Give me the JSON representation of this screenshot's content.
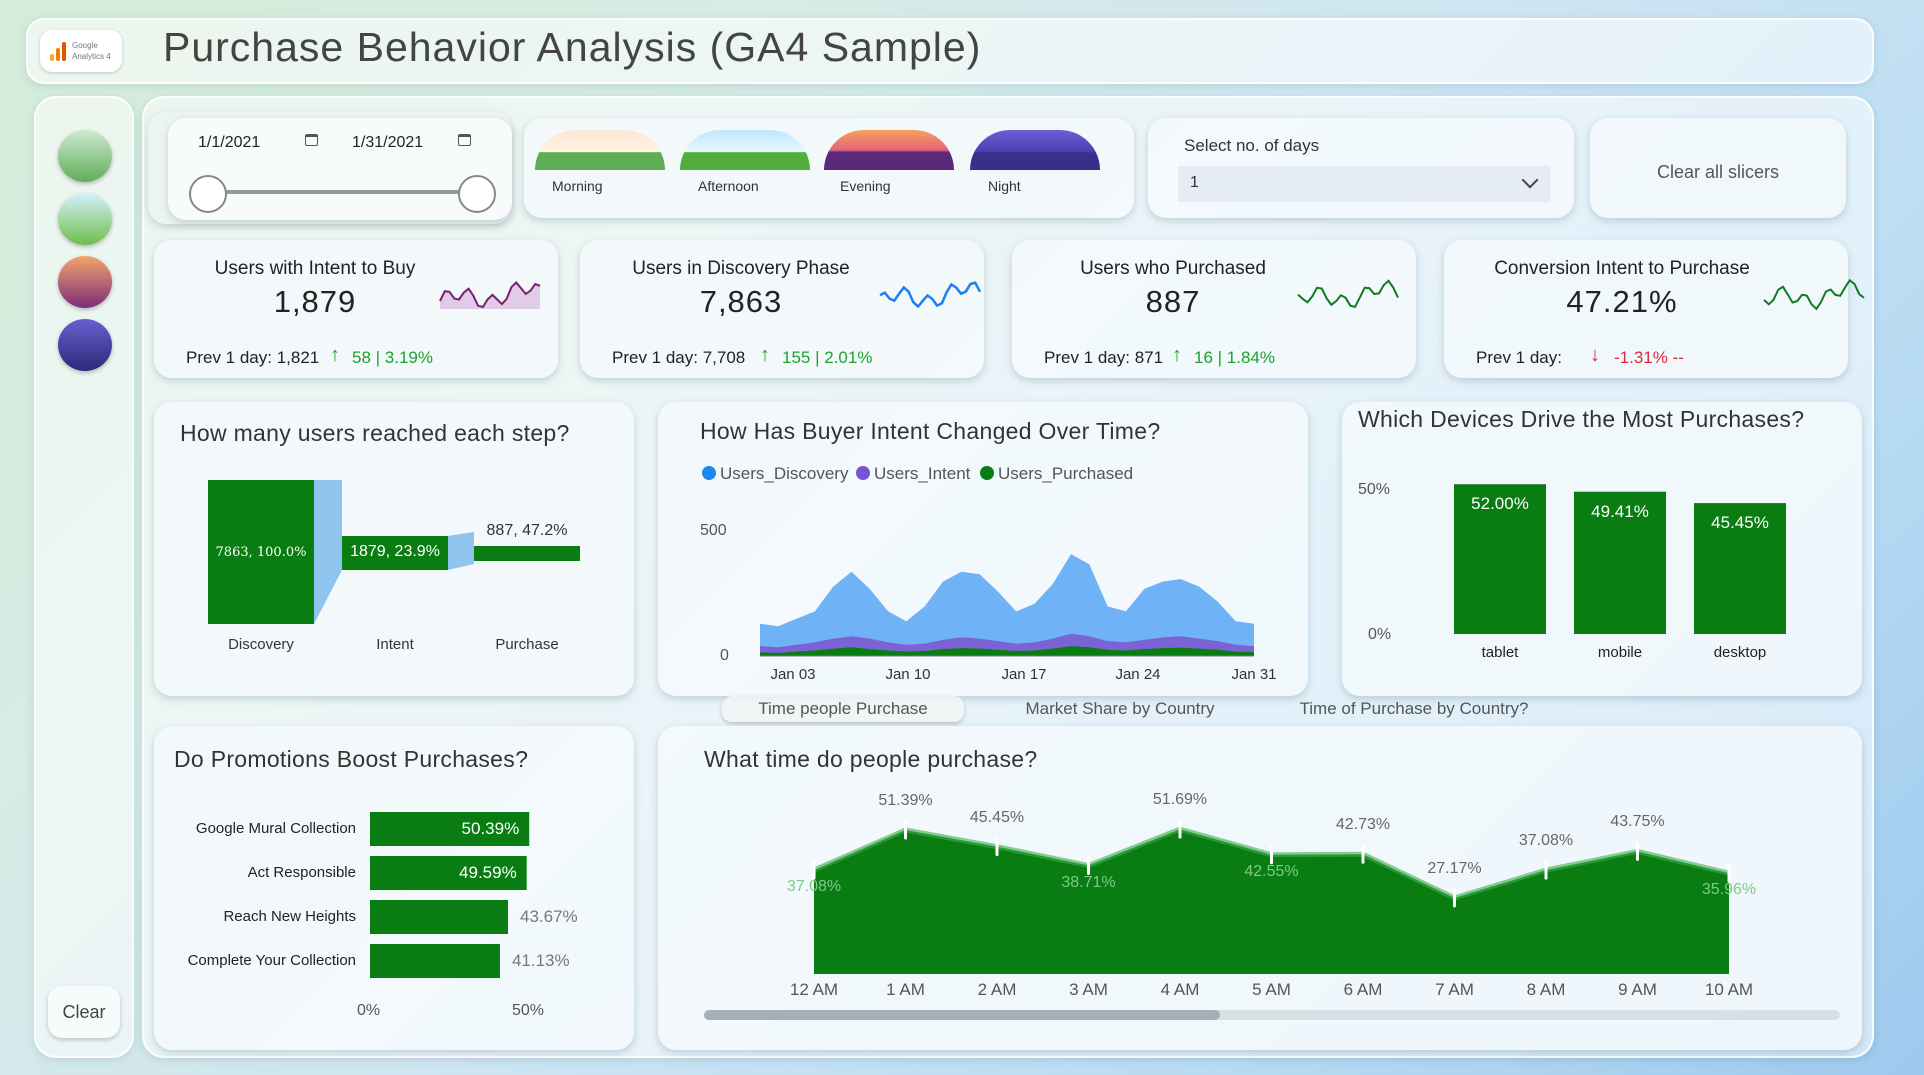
{
  "header": {
    "title": "Purchase Behavior Analysis (GA4 Sample)",
    "logo_line1": "Google",
    "logo_line2": "Analytics 4"
  },
  "sidebar": {
    "icons": [
      "morning-icon",
      "afternoon-icon",
      "evening-icon",
      "night-icon"
    ],
    "clear_label": "Clear"
  },
  "filters": {
    "date_start": "1/1/2021",
    "date_end": "1/31/2021",
    "times": [
      {
        "label": "Morning"
      },
      {
        "label": "Afternoon"
      },
      {
        "label": "Evening"
      },
      {
        "label": "Night"
      }
    ],
    "days_label": "Select no. of days",
    "days_value": "1",
    "clear_all": "Clear all slicers"
  },
  "kpis": [
    {
      "title": "Users with Intent to Buy",
      "value": "1,879",
      "prev": "Prev 1 day: 1,821",
      "arrow": "↑",
      "delta": "58 | 3.19%",
      "delta_color": "#1fa02c",
      "spark_color": "#7a1f6e"
    },
    {
      "title": "Users in Discovery Phase",
      "value": "7,863",
      "prev": "Prev 1 day: 7,708",
      "arrow": "↑",
      "delta": "155 | 2.01%",
      "delta_color": "#1fa02c",
      "spark_color": "#1e7ff0"
    },
    {
      "title": "Users who Purchased",
      "value": "887",
      "prev": "Prev 1 day: 871",
      "arrow": "↑",
      "delta": "16 | 1.84%",
      "delta_color": "#1fa02c",
      "spark_color": "#127a1e"
    },
    {
      "title": "Conversion Intent to Purchase",
      "value": "47.21%",
      "prev": "Prev 1 day:",
      "arrow": "↓",
      "delta": "-1.31% --",
      "delta_color": "#e0283c",
      "spark_color": "#127a1e"
    }
  ],
  "funnel": {
    "title": "How many users reached each step?",
    "steps": [
      {
        "label": "Discovery",
        "value": "7863, 100.0%"
      },
      {
        "label": "Intent",
        "value": "1879, 23.9%"
      },
      {
        "label": "Purchase",
        "value": "887, 47.2%"
      }
    ]
  },
  "intent_chart": {
    "title": "How Has Buyer Intent Changed Over Time?",
    "legend": [
      {
        "name": "Users_Discovery",
        "color": "#1e88f0"
      },
      {
        "name": "Users_Intent",
        "color": "#7b52d6"
      },
      {
        "name": "Users_Purchased",
        "color": "#0a7d12"
      }
    ],
    "y_ticks": [
      "500",
      "0"
    ],
    "x_ticks": [
      "Jan 03",
      "Jan 10",
      "Jan 17",
      "Jan 24",
      "Jan 31"
    ]
  },
  "devices": {
    "title": "Which Devices Drive the Most Purchases?",
    "y_ticks": [
      "50%",
      "0%"
    ]
  },
  "tabs": [
    "Time people Purchase",
    "Market Share by Country",
    "Time of Purchase by Country?"
  ],
  "promotions": {
    "title": "Do Promotions Boost Purchases?",
    "x_ticks": [
      "0%",
      "50%"
    ]
  },
  "hourly": {
    "title": "What time do people purchase?"
  },
  "chart_data": [
    {
      "type": "bar",
      "title": "Which Devices Drive the Most Purchases?",
      "categories": [
        "tablet",
        "mobile",
        "desktop"
      ],
      "values": [
        52.0,
        49.41,
        45.45
      ],
      "labels": [
        "52.00%",
        "49.41%",
        "45.45%"
      ],
      "ylim": [
        0,
        55
      ],
      "color": "#0a7d12"
    },
    {
      "type": "bar",
      "orientation": "horizontal",
      "title": "Do Promotions Boost Purchases?",
      "categories": [
        "Google Mural Collection",
        "Act Responsible",
        "Reach New Heights",
        "Complete Your Collection"
      ],
      "values": [
        50.39,
        49.59,
        43.67,
        41.13
      ],
      "labels": [
        "50.39%",
        "49.59%",
        "43.67%",
        "41.13%"
      ],
      "xlim": [
        0,
        50
      ],
      "color": "#0a7d12"
    },
    {
      "type": "area",
      "title": "What time do people purchase?",
      "categories": [
        "12 AM",
        "1 AM",
        "2 AM",
        "3 AM",
        "4 AM",
        "5 AM",
        "6 AM",
        "7 AM",
        "8 AM",
        "9 AM",
        "10 AM"
      ],
      "values": [
        37.08,
        51.39,
        45.45,
        38.71,
        51.69,
        42.55,
        42.73,
        27.17,
        37.08,
        43.75,
        35.96
      ],
      "labels": [
        "37.08%",
        "51.39%",
        "45.45%",
        "38.71%",
        "51.69%",
        "42.55%",
        "42.73%",
        "27.17%",
        "37.08%",
        "43.75%",
        "35.96%"
      ],
      "label_inside": [
        true,
        false,
        false,
        true,
        false,
        true,
        false,
        false,
        false,
        false,
        true
      ],
      "ylim": [
        0,
        55
      ],
      "color": "#0a7d12"
    },
    {
      "type": "area",
      "title": "How Has Buyer Intent Changed Over Time?",
      "x": [
        "Jan 03",
        "Jan 10",
        "Jan 17",
        "Jan 24",
        "Jan 31"
      ],
      "series": [
        {
          "name": "Users_Discovery",
          "values": [
            130,
            120,
            150,
            180,
            280,
            340,
            270,
            180,
            140,
            200,
            300,
            340,
            330,
            260,
            180,
            210,
            290,
            410,
            370,
            200,
            180,
            270,
            300,
            310,
            280,
            220,
            140,
            130
          ]
        },
        {
          "name": "Users_Intent",
          "values": [
            40,
            35,
            45,
            55,
            70,
            80,
            70,
            55,
            45,
            50,
            65,
            75,
            70,
            60,
            50,
            55,
            70,
            90,
            80,
            60,
            55,
            65,
            75,
            80,
            70,
            60,
            45,
            40
          ]
        },
        {
          "name": "Users_Purchased",
          "values": [
            15,
            12,
            18,
            22,
            30,
            35,
            28,
            22,
            18,
            20,
            28,
            32,
            30,
            25,
            20,
            22,
            30,
            40,
            35,
            25,
            22,
            28,
            32,
            34,
            30,
            25,
            18,
            15
          ]
        }
      ],
      "ylim": [
        0,
        500
      ]
    }
  ]
}
